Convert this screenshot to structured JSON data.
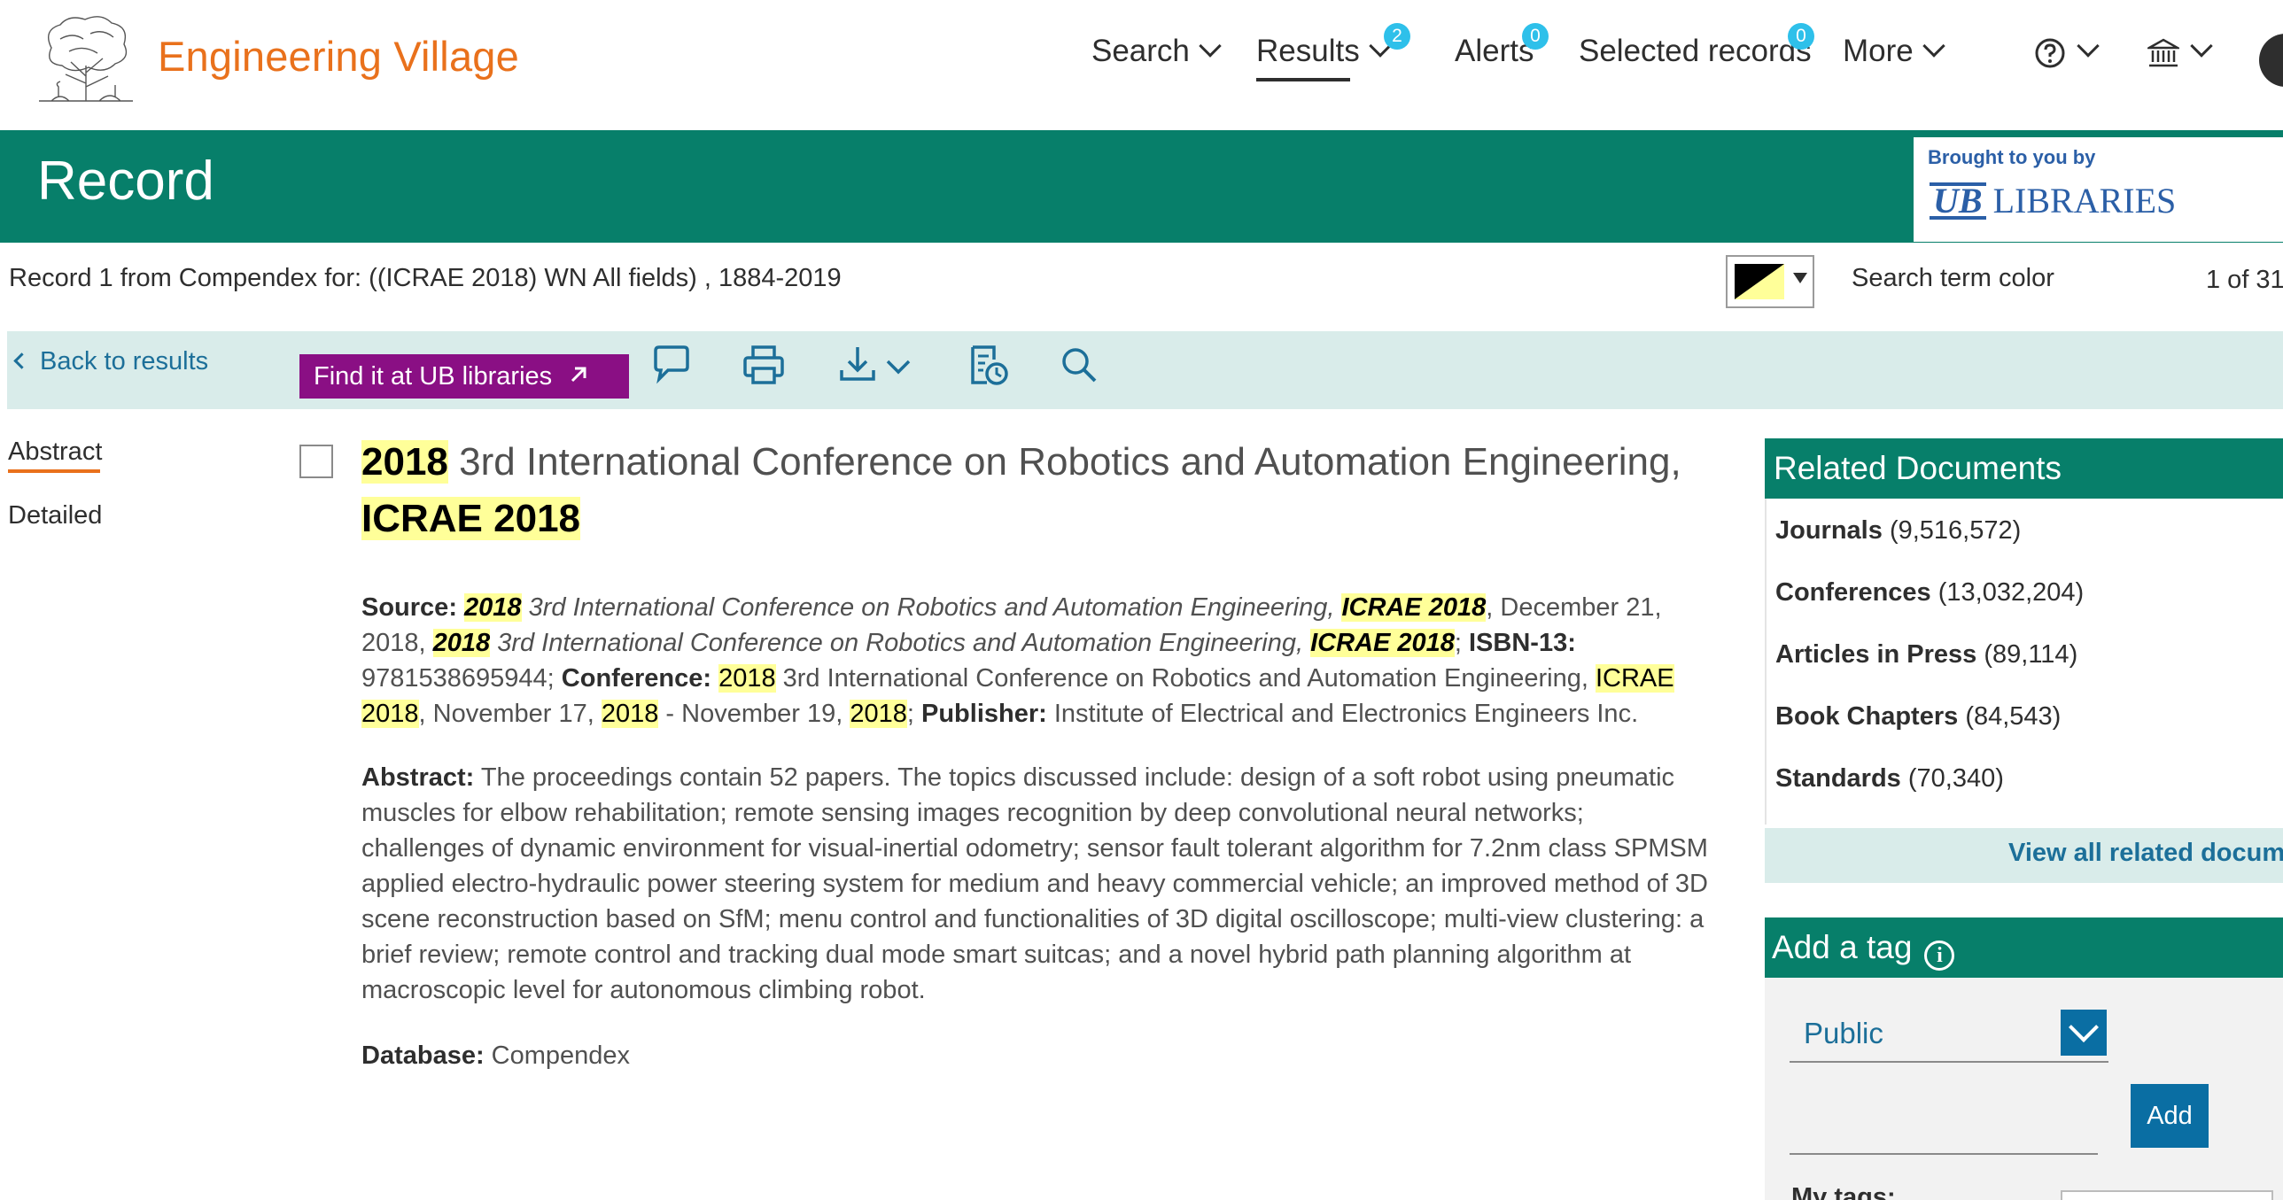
{
  "brand": {
    "name": "Engineering Village"
  },
  "nav": {
    "search": "Search",
    "results": "Results",
    "results_badge": "2",
    "alerts": "Alerts",
    "alerts_badge": "0",
    "selected": "Selected records",
    "selected_badge": "0",
    "more": "More"
  },
  "banner": {
    "title": "Record",
    "inst_brought": "Brought to you by",
    "inst_ub": "UB",
    "inst_name": "LIBRARIES"
  },
  "record_info": {
    "text": "Record 1 from Compendex for: ((ICRAE 2018) WN All fields) , 1884-2019",
    "search_term_color_label": "Search term color",
    "pager": "1 of 31"
  },
  "toolbar": {
    "back_label": "Back to results",
    "findit_label": "Find it at UB libraries"
  },
  "left_tabs": {
    "abstract": "Abstract",
    "detailed": "Detailed"
  },
  "record": {
    "title_1": "2018",
    "title_2": " 3rd International Conference on Robotics and Automation Engineering, ",
    "title_3": "ICRAE 2018",
    "source_label": "Source:",
    "source_1a": "2018",
    "source_1b": " 3rd International Conference on Robotics and Automation Engineering, ",
    "source_1c": "ICRAE 2018",
    "source_1d": ", December 21, 2018, ",
    "source_2a": "2018",
    "source_2b": " 3rd International Conference on Robotics and Automation Engineering, ",
    "source_2c": "ICRAE 2018",
    "source_2d": ";  ",
    "isbn_label": "ISBN-13:",
    "isbn_value": " 9781538695944; ",
    "conference_label": "Conference:",
    "conf_a": "2018",
    "conf_b": " 3rd International Conference on Robotics and Automation Engineering, ",
    "conf_c": "ICRAE 2018",
    "conf_d": ", November 17, ",
    "conf_e": "2018",
    "conf_f": " - November 19, ",
    "conf_g": "2018",
    "conf_h": "; ",
    "publisher_label": "Publisher:",
    "publisher_value": " Institute of Electrical and Electronics Engineers Inc.",
    "abstract_label": "Abstract:",
    "abstract_text": " The proceedings contain 52 papers. The topics discussed include: design of a soft robot using pneumatic muscles for elbow rehabilitation; remote sensing images recognition by deep convolutional neural networks; challenges of dynamic environment for visual-inertial odometry; sensor fault tolerant algorithm for 7.2nm class SPMSM applied electro-hydraulic power steering system for medium and heavy commercial vehicle; an improved method of 3D scene reconstruction based on SfM; menu control and functionalities of 3D digital oscilloscope; multi-view clustering: a brief review; remote control and tracking dual mode smart suitcas; and a novel hybrid path planning algorithm at macroscopic level for autonomous climbing robot.",
    "database_label": "Database:",
    "database_value": " Compendex"
  },
  "related": {
    "heading": "Related Documents",
    "items": [
      {
        "label": "Journals",
        "count": "(9,516,572)"
      },
      {
        "label": "Conferences",
        "count": "(13,032,204)"
      },
      {
        "label": "Articles in Press",
        "count": "(89,114)"
      },
      {
        "label": "Book Chapters",
        "count": "(84,543)"
      },
      {
        "label": "Standards",
        "count": "(70,340)"
      }
    ],
    "view_all": "View all related documents"
  },
  "tags": {
    "heading": "Add a tag",
    "visibility": "Public",
    "add_label": "Add",
    "my_tags_label": "My tags:"
  },
  "colors": {
    "brand_orange": "#e9711c",
    "header_green": "#077f6a",
    "toolbar_mint": "#d9ecea",
    "findit_purple": "#8a0f84",
    "link_blue": "#1c6f99",
    "badge_blue": "#2ec0ea",
    "highlight_yellow": "#ffff99"
  },
  "icons": [
    "tree-logo-icon",
    "help-icon",
    "institution-icon",
    "external-link-icon",
    "comment-icon",
    "print-icon",
    "download-icon",
    "history-icon",
    "search-icon",
    "info-icon"
  ]
}
